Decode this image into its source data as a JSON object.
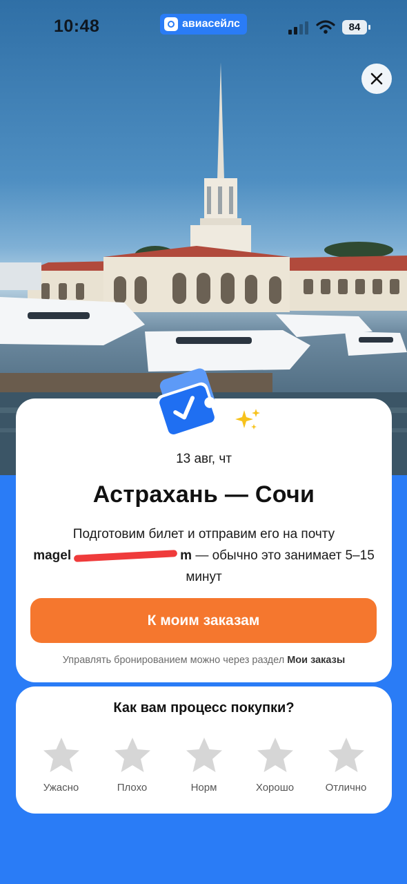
{
  "status_bar": {
    "time": "10:48",
    "app_badge": "авиасейлс",
    "battery": "84"
  },
  "close_icon": "close-icon",
  "trip": {
    "date": "13 авг, чт",
    "route": "Астрахань — Сочи",
    "desc_line1": "Подготовим билет и отправим его на почту",
    "email_visible_start": "magel",
    "email_visible_end": "m",
    "desc_after_email": "— обычно это занимает 5–15 минут"
  },
  "orders_button": "К моим заказам",
  "hint": {
    "text": "Управлять бронированием можно через раздел",
    "link": "Мои заказы"
  },
  "rating": {
    "title": "Как вам процесс покупки?",
    "options": [
      "Ужасно",
      "Плохо",
      "Норм",
      "Хорошо",
      "Отлично"
    ]
  },
  "colors": {
    "brand_blue": "#2a7cf6",
    "cta_orange": "#f5772e",
    "star_gray": "#d6d6d6"
  }
}
